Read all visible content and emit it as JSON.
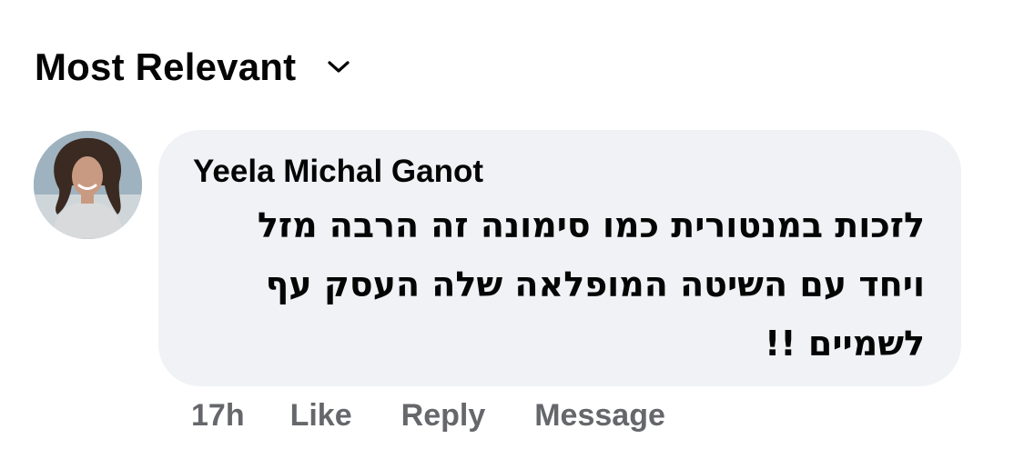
{
  "sort": {
    "label": "Most Relevant"
  },
  "comment": {
    "author": "Yeela Michal Ganot",
    "text_lines": [
      "לזכות במנטורית כמו סימונה זה הרבה מזל",
      "ויחד עם השיטה המופלאה שלה העסק עף",
      "לשמיים !!"
    ],
    "timestamp": "17h",
    "actions": {
      "like": "Like",
      "reply": "Reply",
      "message": "Message"
    }
  },
  "icons": {
    "sort_toggle": "chevron-down-icon"
  },
  "colors": {
    "bubble": "#f0f2f5",
    "text": "#050505",
    "secondary": "#65676b"
  }
}
